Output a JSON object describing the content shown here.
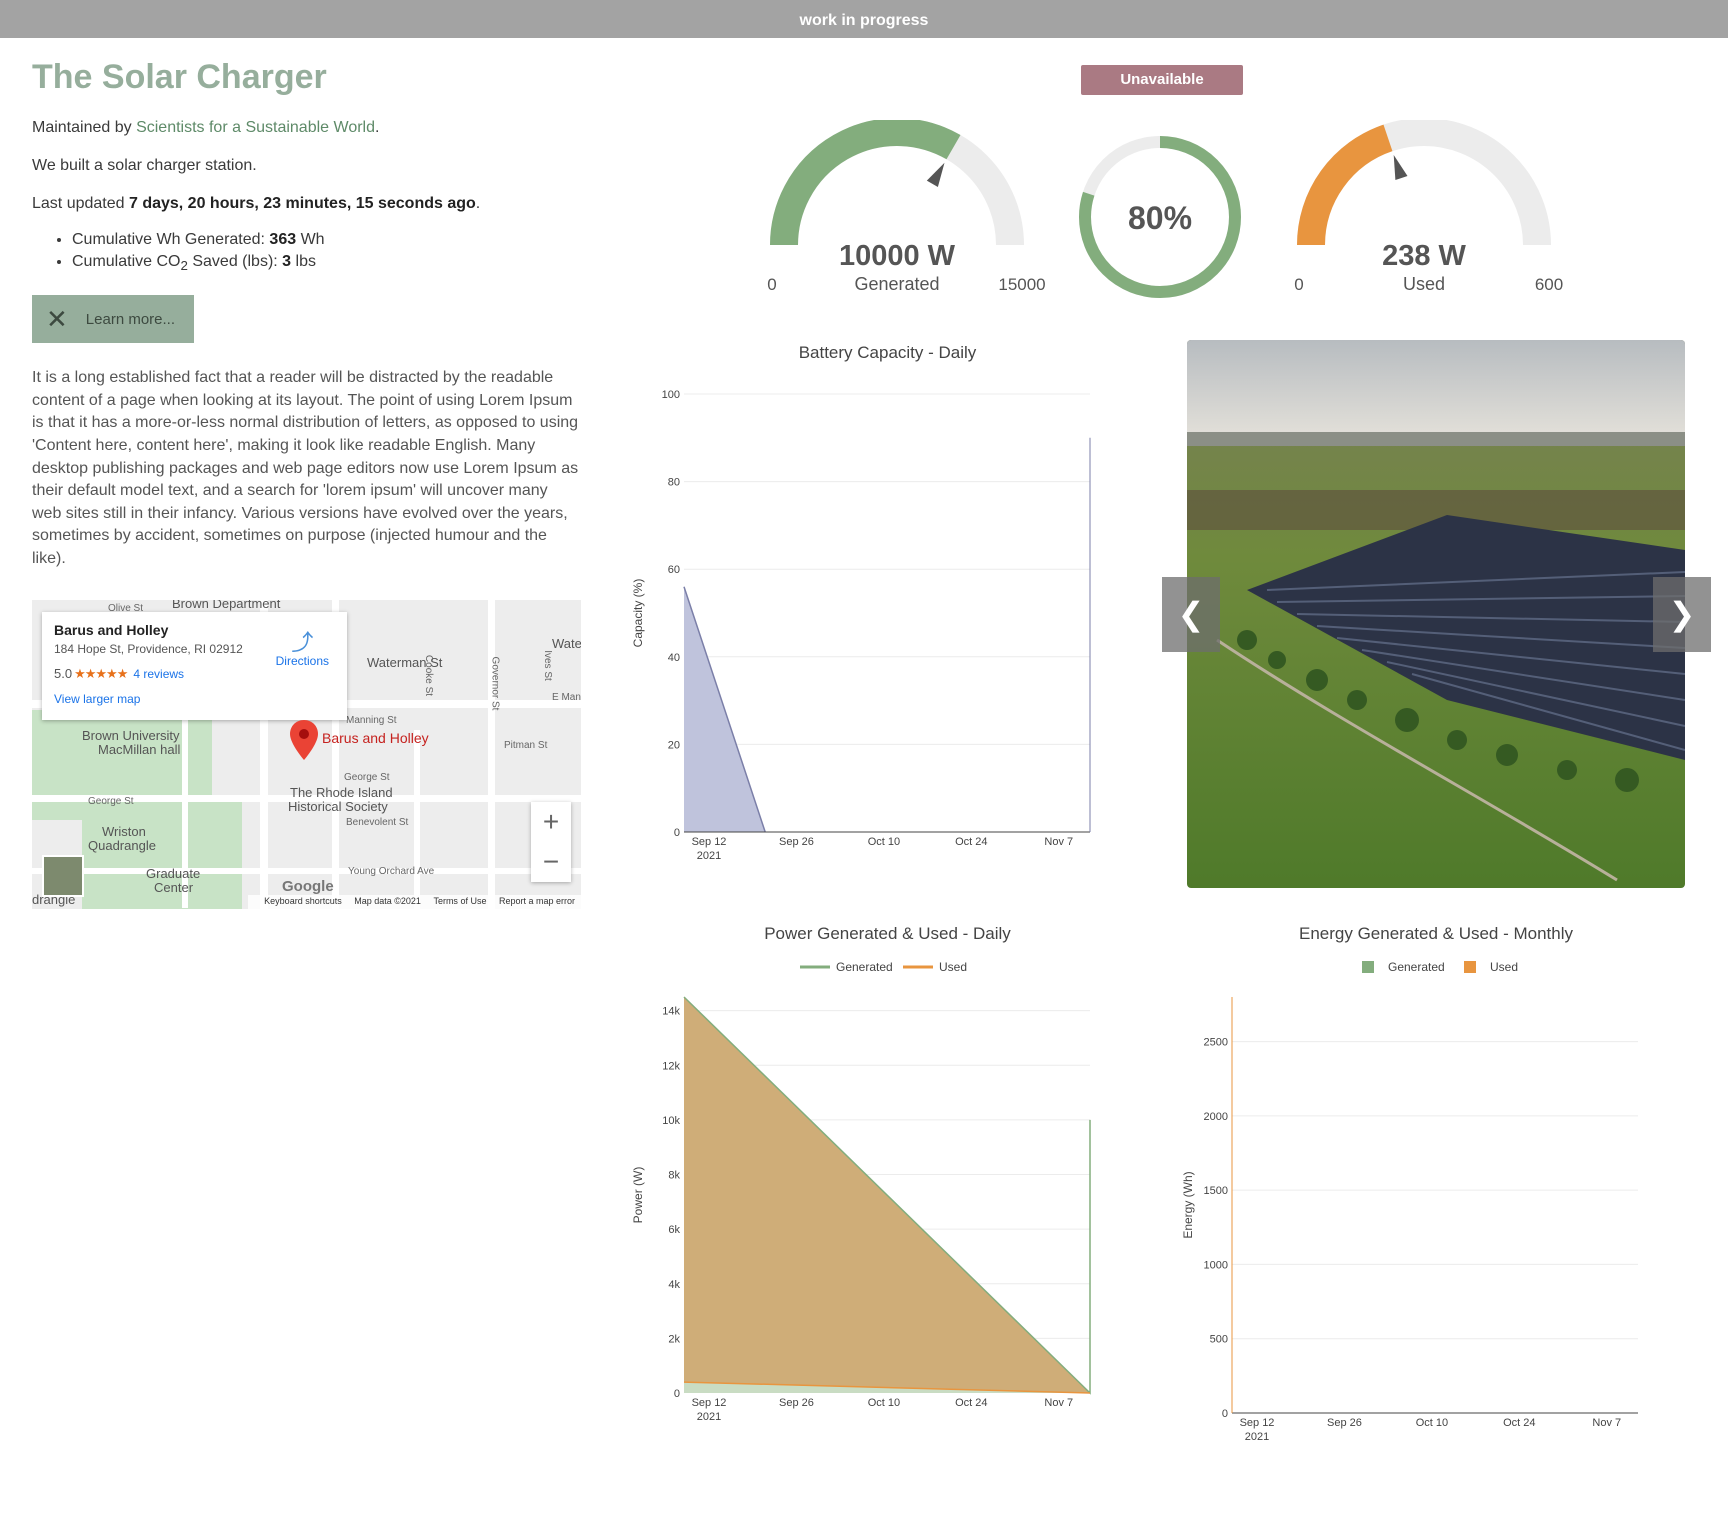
{
  "banner": "work in progress",
  "left": {
    "title": "The Solar Charger",
    "maintained_prefix": "Maintained by ",
    "maintained_link": "Scientists for a Sustainable World",
    "maintained_suffix": ".",
    "built": "We built a solar charger station.",
    "updated_prefix": "Last updated ",
    "updated_value": "7 days, 20 hours, 23 minutes, 15 seconds ago",
    "updated_suffix": ".",
    "stats": [
      {
        "label": "Cumulative Wh Generated: ",
        "value": "363",
        "unit": " Wh"
      },
      {
        "label_a": "Cumulative CO",
        "label_sub": "2",
        "label_b": " Saved (lbs): ",
        "value": "3",
        "unit": " lbs"
      }
    ],
    "learn_more": "Learn more...",
    "lorem": "It is a long established fact that a reader will be distracted by the readable content of a page when looking at its layout. The point of using Lorem Ipsum is that it has a more-or-less normal distribution of letters, as opposed to using 'Content here, content here', making it look like readable English. Many desktop publishing packages and web page editors now use Lorem Ipsum as their default model text, and a search for 'lorem ipsum' will uncover many web sites still in their infancy. Various versions have evolved over the years, sometimes by accident, sometimes on purpose (injected humour and the like)."
  },
  "map": {
    "place_name": "Barus and Holley",
    "address": "184 Hope St, Providence, RI 02912",
    "rating": "5.0",
    "stars": "★★★★★",
    "reviews": "4 reviews",
    "larger_map": "View larger map",
    "directions": "Directions",
    "pin_label": "Barus and Holley",
    "labels": {
      "waterman": "Waterman St",
      "brown_univ": "Brown University",
      "macmillan": "MacMillan hall",
      "wriston": "Wriston",
      "quadrangle": "Quadrangle",
      "graduate": "Graduate",
      "center": "Center",
      "rhode_island": "The Rhode Island",
      "historical": "Historical Society",
      "manning": "Manning St",
      "george": "George St",
      "george2": "George St",
      "benevolent": "Benevolent St",
      "pitman": "Pitman St",
      "young_orchard": "Young Orchard Ave",
      "water": "Wate",
      "e_mann": "E Mann",
      "brown_dept": "Brown Department",
      "olive": "Olive St",
      "cooke": "Cooke St",
      "governor": "Governor St",
      "ives": "Ives St",
      "drangle": "drangle"
    },
    "google": "Google",
    "footer": [
      "Keyboard shortcuts",
      "Map data ©2021",
      "Terms of Use",
      "Report a map error"
    ],
    "zoom_in": "+",
    "zoom_out": "−"
  },
  "status": "Unavailable",
  "gauges": {
    "generated": {
      "value": 10000,
      "display": "10000 W",
      "label": "Generated",
      "min": "0",
      "max": "15000",
      "max_value": 15000,
      "color": "#83ad7d"
    },
    "battery": {
      "value": 80,
      "display": "80%",
      "color": "#83ad7d"
    },
    "used": {
      "value": 238,
      "display": "238 W",
      "label": "Used",
      "min": "0",
      "max": "600",
      "max_value": 600,
      "color": "#e8953f"
    }
  },
  "colors": {
    "track": "#ececec",
    "battery_fill": "#bfc3dc",
    "battery_line": "#7b7fa8",
    "generated": "#83ad7d",
    "used": "#e8953f",
    "area_fill": "#cfad78"
  },
  "chart_data": [
    {
      "type": "area",
      "title": "Battery Capacity - Daily",
      "ylabel": "Capacity (%)",
      "x_ticks": [
        "Sep 12",
        "Sep 26",
        "Oct 10",
        "Oct 24",
        "Nov 7"
      ],
      "x_sub": "2021",
      "ylim": [
        0,
        100
      ],
      "y_ticks": [
        0,
        20,
        40,
        60,
        80,
        100
      ],
      "series": [
        {
          "x": [
            "2021-09-12",
            "2021-09-25"
          ],
          "values": [
            56,
            0
          ]
        }
      ]
    },
    {
      "type": "area",
      "title": "Power Generated & Used - Daily",
      "ylabel": "Power (W)",
      "legend": [
        "Generated",
        "Used"
      ],
      "x_ticks": [
        "Sep 12",
        "Sep 26",
        "Oct 10",
        "Oct 24",
        "Nov 7"
      ],
      "x_sub": "2021",
      "y_ticks": [
        "0",
        "2k",
        "4k",
        "6k",
        "8k",
        "10k",
        "12k",
        "14k"
      ],
      "ylim": [
        0,
        14500
      ],
      "series": [
        {
          "name": "Generated",
          "x": [
            "2021-09-12",
            "2021-11-16",
            "2021-11-16"
          ],
          "values": [
            14500,
            0,
            10000
          ]
        },
        {
          "name": "Used",
          "x": [
            "2021-09-12",
            "2021-11-16"
          ],
          "values": [
            400,
            0
          ]
        }
      ]
    },
    {
      "type": "bar",
      "title": "Energy Generated & Used - Monthly",
      "ylabel": "Energy (Wh)",
      "legend": [
        "Generated",
        "Used"
      ],
      "x_ticks": [
        "Sep 12",
        "Sep 26",
        "Oct 10",
        "Oct 24",
        "Nov 7"
      ],
      "x_sub": "2021",
      "y_ticks": [
        0,
        500,
        1000,
        1500,
        2000,
        2500
      ],
      "ylim": [
        0,
        2800
      ],
      "series": [
        {
          "name": "Generated",
          "values": []
        },
        {
          "name": "Used",
          "values": []
        }
      ]
    }
  ]
}
